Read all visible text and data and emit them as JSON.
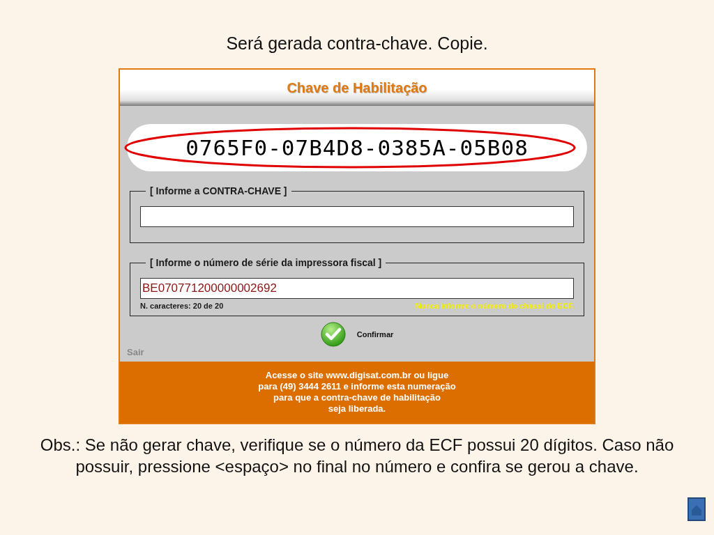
{
  "slide": {
    "heading": "Será gerada contra-chave. Copie.",
    "note": "Obs.: Se não gerar chave, verifique se o número da ECF possui 20 dígitos. Caso não possuir, pressione <espaço> no final no número e confira se gerou a chave."
  },
  "window": {
    "title": "Chave de Habilitação",
    "generated_key": {
      "value": "0765F0-07B4D8-0385A-05B08",
      "highlighted": true
    },
    "counter_key": {
      "legend": "[ Informe a CONTRA-CHAVE ]"
    },
    "serial": {
      "legend": "[ Informe o número de série da impressora fiscal ]",
      "value": "BE070771200000002692",
      "char_count": "N. caracteres: 20 de 20",
      "warning": "Nunca informe o número do chassi do ECF."
    },
    "confirm_button": {
      "label": "Confirmar"
    },
    "exit_link": {
      "label": "Sair"
    },
    "footer": {
      "lines": [
        "Acesse o site www.digisat.com.br ou ligue",
        "para (49) 3444 2611 e informe esta numeração",
        "para que a contra-chave de habilitação",
        "seja liberada."
      ]
    }
  }
}
